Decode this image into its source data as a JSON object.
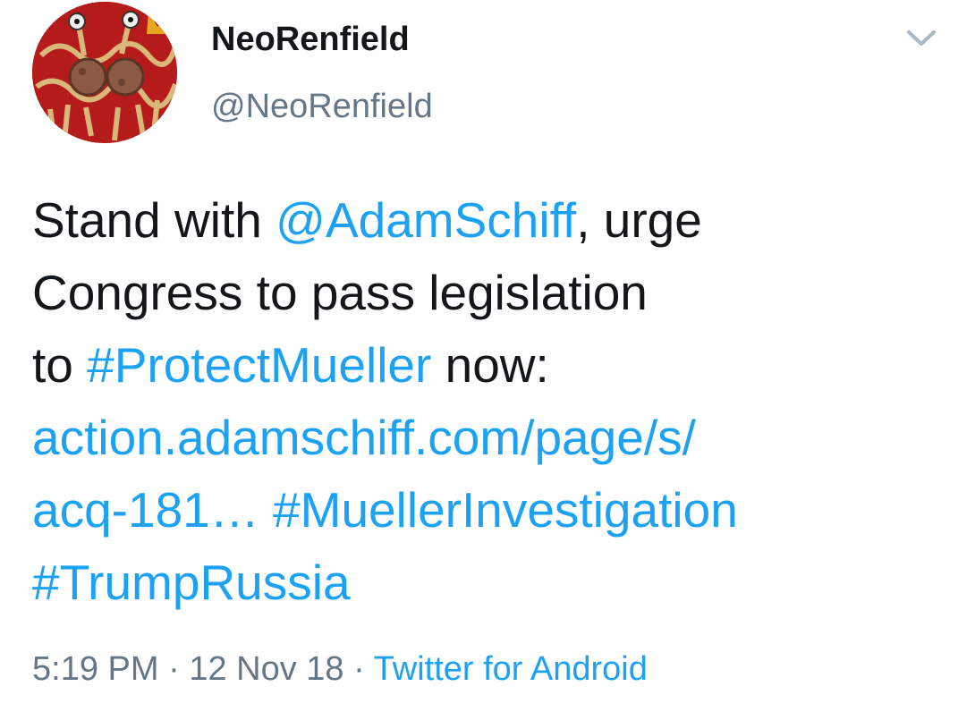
{
  "user": {
    "display_name": "NeoRenfield",
    "handle": "@NeoRenfield"
  },
  "menu": {
    "icon": "chevron-down-icon"
  },
  "tweet": {
    "line1_pre": "Stand with ",
    "mention": "@AdamSchiff",
    "line1_post": ", urge",
    "line2": "Congress to pass legislation",
    "line3_pre": "to ",
    "hashtag_protect": "#ProtectMueller",
    "line3_post": " now:",
    "url_part1": "action.adamschiff.com/page/s/",
    "url_part2": "acq-181…",
    "hashtag_investigation": "#MuellerInvestigation",
    "hashtag_trumprussia": "#TrumpRussia"
  },
  "meta": {
    "time": "5:19 PM",
    "separator": " · ",
    "date": "12 Nov 18",
    "source": "Twitter for Android"
  },
  "colors": {
    "link": "#1da1f2",
    "text": "#14171a",
    "secondary": "#657786",
    "avatar_bg": "#b51b1b"
  }
}
